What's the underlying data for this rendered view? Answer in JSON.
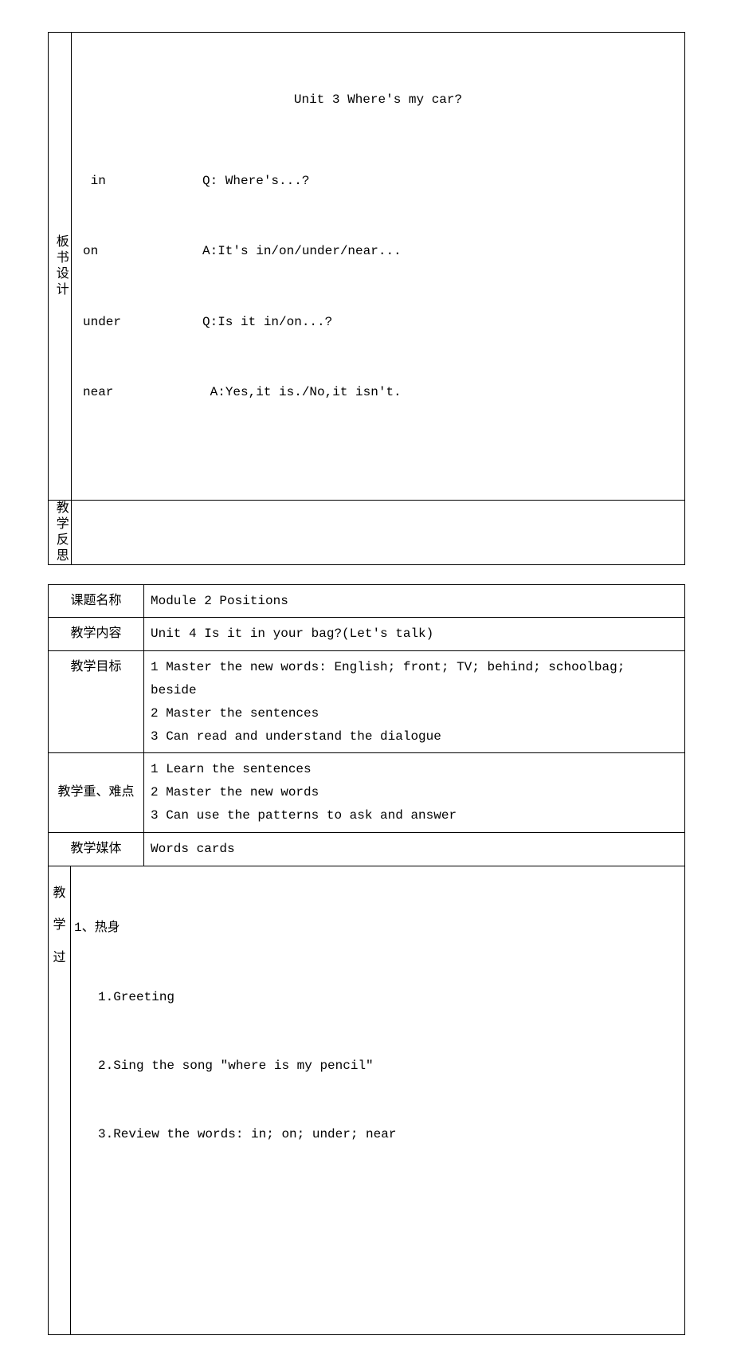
{
  "board": {
    "label": "板书设计",
    "title": "Unit 3 Where's my car?",
    "rows": [
      {
        "left": " in",
        "right": "Q: Where's...?"
      },
      {
        "left": "on",
        "right": "A:It's in/on/under/near..."
      },
      {
        "left": "under",
        "right": "Q:Is it in/on...?"
      },
      {
        "left": "near",
        "right": " A:Yes,it is./No,it isn't."
      }
    ]
  },
  "reflection": {
    "label": "教学反思",
    "content": ""
  },
  "lesson": {
    "topic_label": "课题名称",
    "topic_value": "Module 2 Positions",
    "content_label": "教学内容",
    "content_value": "Unit 4 Is it in your bag?(Let's talk)",
    "goal_label": "教学目标",
    "goal_value": "1 Master the new words: English; front; TV; behind; schoolbag; beside\n2 Master the sentences\n3 Can read and understand the dialogue",
    "focus_label": "教学重、难点",
    "focus_value": "1 Learn the sentences\n2 Master the new words\n3 Can use the patterns to ask and answer",
    "media_label": "教学媒体",
    "media_value": "Words cards",
    "process_label_chars": [
      "教",
      "学",
      "过"
    ],
    "process": {
      "heading": "1、热身",
      "lines": [
        "1.Greeting",
        "2.Sing the song \"where is my pencil\"",
        "3.Review the words: in; on; under; near"
      ]
    }
  }
}
